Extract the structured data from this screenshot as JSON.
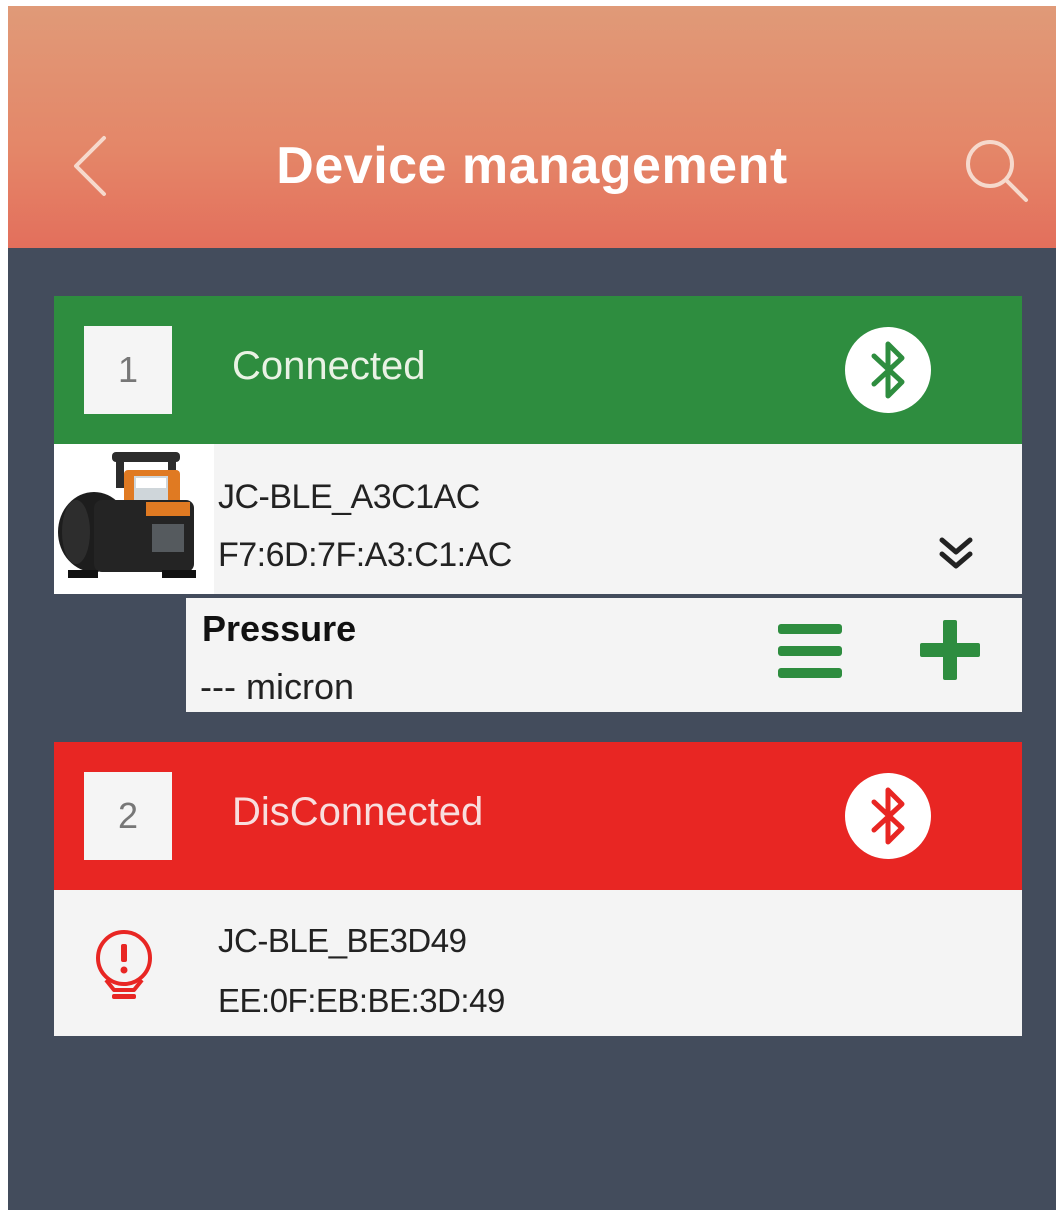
{
  "header": {
    "title": "Device management",
    "back_icon": "chevron-left-icon",
    "search_icon": "search-icon"
  },
  "devices": [
    {
      "index": "1",
      "status": "Connected",
      "status_color": "#2e8d3f",
      "icon": "bluetooth-icon",
      "name": "JC-BLE_A3C1AC",
      "address": "F7:6D:7F:A3:C1:AC",
      "expand_icon": "double-chevron-down-icon",
      "reading": {
        "label": "Pressure",
        "value": "--- micron",
        "menu_icon": "menu-icon",
        "add_icon": "plus-icon"
      }
    },
    {
      "index": "2",
      "status": "DisConnected",
      "status_color": "#e82623",
      "icon": "bluetooth-icon",
      "name": "JC-BLE_BE3D49",
      "address": "EE:0F:EB:BE:3D:49",
      "alert_icon": "gauge-alert-icon"
    }
  ],
  "colors": {
    "header_gradient_top": "#e09a78",
    "header_gradient_bottom": "#e36f5c",
    "background": "#434c5c",
    "accent_green": "#2e8d3f",
    "accent_red": "#e82623"
  }
}
